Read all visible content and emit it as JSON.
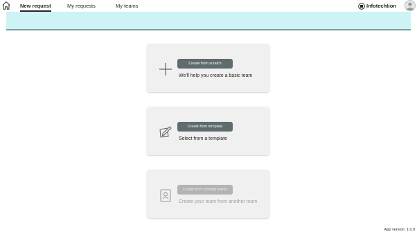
{
  "nav": {
    "tabs": [
      {
        "label": "New request",
        "active": true
      },
      {
        "label": "My requests",
        "active": false
      },
      {
        "label": "My teams",
        "active": false
      }
    ],
    "brand": "Infotechtion",
    "icons": {
      "home": "home-icon",
      "brand": "infotechtion-logo-icon",
      "avatar": "user-avatar-icon"
    }
  },
  "banner": {
    "color": "#cdf3f4"
  },
  "cards": [
    {
      "button": "Create from scratch",
      "description": "We'll help you create a basic team",
      "icon": "plus-icon",
      "enabled": true
    },
    {
      "button": "Create from template",
      "description": "Select from a template",
      "icon": "template-edit-icon",
      "enabled": true
    },
    {
      "button": "Create from existing teams",
      "description": "Create your team from another team",
      "icon": "contact-book-icon",
      "enabled": false
    }
  ],
  "footer": {
    "version": "App version: 1.0.0"
  },
  "colors": {
    "button": "#5f6b6d",
    "button_disabled": "#b3b3b3",
    "card_bg": "#f0f0f0",
    "banner": "#cdf3f4"
  }
}
